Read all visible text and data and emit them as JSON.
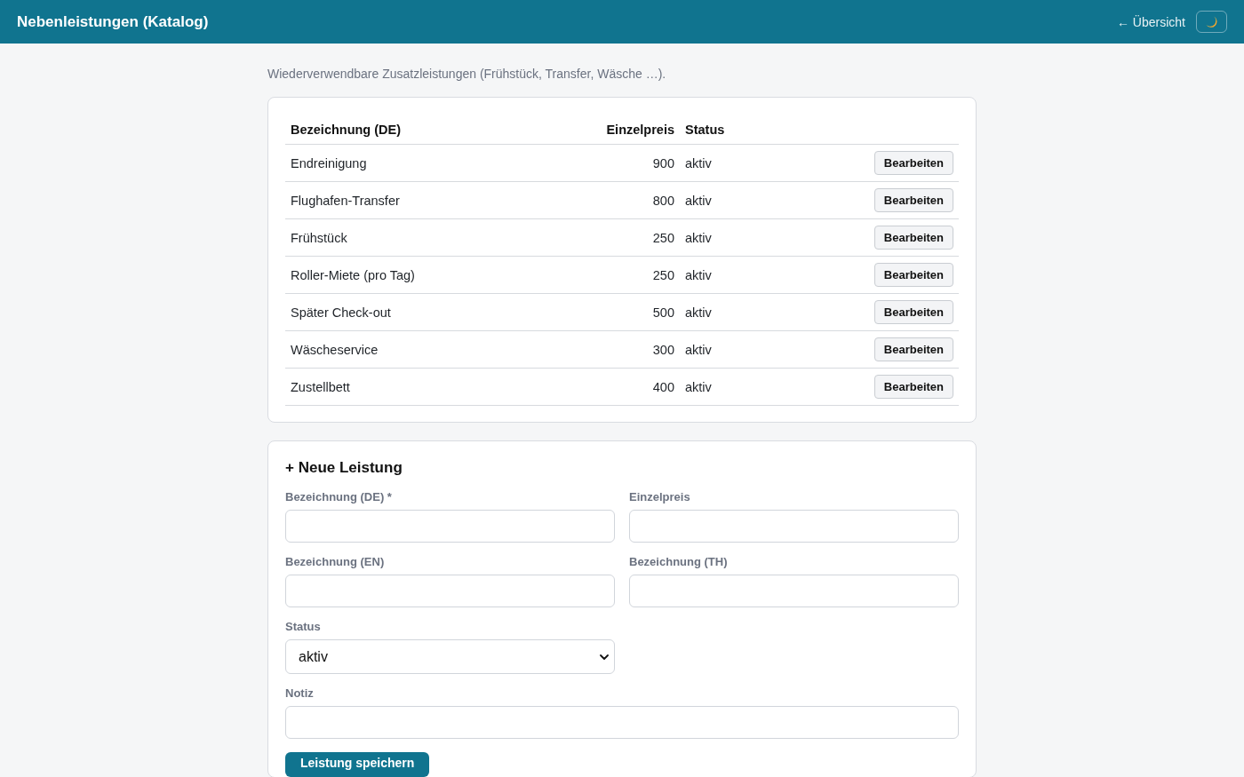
{
  "header": {
    "title": "Nebenleistungen (Katalog)",
    "back_link": "← Übersicht"
  },
  "intro": "Wiederverwendbare Zusatzleistungen (Frühstück, Transfer, Wäsche …).",
  "table": {
    "columns": [
      "Bezeichnung (DE)",
      "Einzelpreis",
      "Status"
    ],
    "rows": [
      {
        "name": "Endreinigung",
        "price": "900",
        "status": "aktiv",
        "action": "Bearbeiten"
      },
      {
        "name": "Flughafen-Transfer",
        "price": "800",
        "status": "aktiv",
        "action": "Bearbeiten"
      },
      {
        "name": "Frühstück",
        "price": "250",
        "status": "aktiv",
        "action": "Bearbeiten"
      },
      {
        "name": "Roller-Miete (pro Tag)",
        "price": "250",
        "status": "aktiv",
        "action": "Bearbeiten"
      },
      {
        "name": "Später Check-out",
        "price": "500",
        "status": "aktiv",
        "action": "Bearbeiten"
      },
      {
        "name": "Wäscheservice",
        "price": "300",
        "status": "aktiv",
        "action": "Bearbeiten"
      },
      {
        "name": "Zustellbett",
        "price": "400",
        "status": "aktiv",
        "action": "Bearbeiten"
      }
    ]
  },
  "form": {
    "title": "+ Neue Leistung",
    "fields": [
      {
        "label": "Bezeichnung (DE) *"
      },
      {
        "label": "Einzelpreis"
      },
      {
        "label": "Bezeichnung (EN)"
      },
      {
        "label": "Bezeichnung (TH)"
      }
    ],
    "status": {
      "label": "Status",
      "value": "aktiv"
    },
    "note": {
      "label": "Notiz"
    },
    "submit": "Leistung speichern"
  }
}
